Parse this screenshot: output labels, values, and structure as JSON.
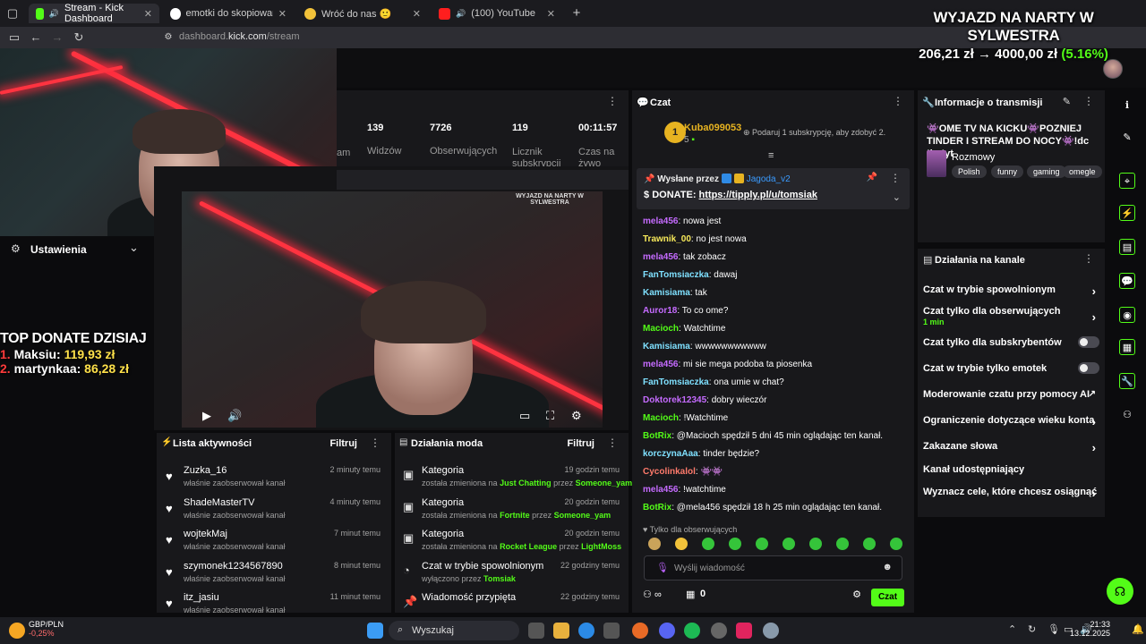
{
  "browser": {
    "tabs": [
      {
        "title": "Stream - Kick Dashboard",
        "active": true
      },
      {
        "title": "emotki do skopiowania - Szuka"
      },
      {
        "title": "Wróć do nas 🙂"
      },
      {
        "title": "(100) YouTube"
      }
    ],
    "url_host": "dashboard.",
    "url_domain": "kick.com",
    "url_path": "/stream"
  },
  "overlay": {
    "goal_title": "WYJAZD NA NARTY W SYLWESTRA",
    "goal_value": "206,21 zł → 4000,00 zł",
    "goal_percent": "(5.16%)",
    "goal_progress": 0.0516,
    "top_donate_title": "TOP DONATE DZISIAJ",
    "top_donate": [
      {
        "rank": "1.",
        "name": "Maksiu:",
        "amount": "119,93 zł"
      },
      {
        "rank": "2.",
        "name": "martynkaa:",
        "amount": "86,28 zł"
      }
    ]
  },
  "settings_label": "Ustawienia",
  "stats": [
    {
      "value": "139",
      "label": "Widzów"
    },
    {
      "value": "7726",
      "label": "Obserwujących"
    },
    {
      "value": "119",
      "label": "Licznik subskrypcji"
    },
    {
      "value": "00:11:57",
      "label": "Czas na żywo"
    }
  ],
  "stats_partial_label": "am",
  "activity": {
    "title": "Lista aktywności",
    "filter": "Filtruj",
    "items": [
      {
        "name": "Zuzka_16",
        "sub": "właśnie zaobserwował kanał",
        "time": "2 minuty temu"
      },
      {
        "name": "ShadeMasterTV",
        "sub": "właśnie zaobserwował kanał",
        "time": "4 minuty temu"
      },
      {
        "name": "wojtekMaj",
        "sub": "właśnie zaobserwował kanał",
        "time": "7 minut temu"
      },
      {
        "name": "szymonek1234567890",
        "sub": "właśnie zaobserwował kanał",
        "time": "8 minut temu"
      },
      {
        "name": "itz_jasiu",
        "sub": "właśnie zaobserwował kanał",
        "time": "11 minut temu"
      }
    ]
  },
  "mods": {
    "title": "Działania moda",
    "filter": "Filtruj",
    "items": [
      {
        "name": "Kategoria",
        "pre": "została zmieniona na",
        "target": "Just Chatting",
        "mid": "przez",
        "by": "Someone_yam",
        "time": "19 godzin temu"
      },
      {
        "name": "Kategoria",
        "pre": "została zmieniona na",
        "target": "Fortnite",
        "mid": "przez",
        "by": "Someone_yam",
        "time": "20 godzin temu"
      },
      {
        "name": "Kategoria",
        "pre": "została zmieniona na",
        "target": "Rocket League",
        "mid": "przez",
        "by": "LightMoss",
        "time": "20 godzin temu"
      },
      {
        "name": "Czat w trybie spowolnionym",
        "pre": "wyłączono przez",
        "target": "Tomsiak",
        "mid": "",
        "by": "",
        "time": "22 godziny temu"
      },
      {
        "name": "Wiadomość przypięta",
        "pre": "",
        "target": "",
        "mid": "",
        "by": "",
        "time": "22 godziny temu"
      }
    ]
  },
  "chat": {
    "title": "Czat",
    "leader_rank": "1",
    "leader_name": "Kuba099053",
    "leader_count": "5",
    "sub_hint": "Podaruj 1 subskrypcję, aby zdobyć 2.",
    "pinned_by_label": "Wysłane przez",
    "pinned_by_user": "Jagoda_v2",
    "pinned_msg_prefix": "DONATE:",
    "pinned_msg_link": "https://tipply.pl/u/tomsiak",
    "messages": [
      {
        "user": "mela456",
        "color": "#c56bff",
        "text": ": nowa jest"
      },
      {
        "user": "Trawnik_00",
        "color": "#f7e95a",
        "text": ": no jest nowa"
      },
      {
        "user": "mela456",
        "color": "#c56bff",
        "text": ": tak zobacz"
      },
      {
        "user": "FanTomsiaczka",
        "color": "#7fe0ff",
        "text": ": dawaj"
      },
      {
        "user": "Kamisiama",
        "color": "#7fe0ff",
        "text": ": tak"
      },
      {
        "user": "Auror18",
        "color": "#c56bff",
        "text": ": To co ome?"
      },
      {
        "user": "Macioch",
        "color": "#53fc18",
        "text": ": Watchtime"
      },
      {
        "user": "Kamisiama",
        "color": "#7fe0ff",
        "text": ": wwwwwwwwwww"
      },
      {
        "user": "mela456",
        "color": "#c56bff",
        "text": ": mi sie mega podoba ta piosenka"
      },
      {
        "user": "FanTomsiaczka",
        "color": "#7fe0ff",
        "text": ": ona umie w chat?"
      },
      {
        "user": "Doktorek12345",
        "color": "#c56bff",
        "text": ": dobry wieczór"
      },
      {
        "user": "Macioch",
        "color": "#53fc18",
        "text": ": !Watchtime"
      },
      {
        "user": "BotRix",
        "color": "#53fc18",
        "text": ": @Macioch spędził 5 dni 45 min oglądając ten kanał."
      },
      {
        "user": "korczynaAaa",
        "color": "#7fe0ff",
        "text": ": tinder będzie?"
      },
      {
        "user": "Cycolinkalol",
        "color": "#ff7a6b",
        "text": ": 👾👾"
      },
      {
        "user": "mela456",
        "color": "#c56bff",
        "text": ": !watchtime"
      },
      {
        "user": "BotRix",
        "color": "#53fc18",
        "text": ": @mela456 spędził 18 h 25 min oglądając ten kanał."
      }
    ],
    "only_followers": "♥ Tylko dla obserwujących",
    "input_placeholder": "Wyślij wiadomość",
    "infinity": "∞",
    "gift_count": "0",
    "send_label": "Czat"
  },
  "info": {
    "title": "Informacje o transmisji",
    "stream_title": "👾OME TV NA KICKU👾POZNIEJ TINDER I STREAM DO NOCY👾!dc !ig !yt",
    "category": "Rozmowy",
    "tags": [
      "Polish",
      "funny",
      "gaming",
      "omegle"
    ]
  },
  "actions": {
    "title": "Działania na kanale",
    "items": [
      {
        "label": "Czat w trybie spowolnionym",
        "sub": "",
        "kind": "chevron"
      },
      {
        "label": "Czat tylko dla obserwujących",
        "sub": "1 min",
        "kind": "chevron"
      },
      {
        "label": "Czat tylko dla subskrybentów",
        "sub": "",
        "kind": "toggle"
      },
      {
        "label": "Czat w trybie tylko emotek",
        "sub": "",
        "kind": "toggle"
      },
      {
        "label": "Moderowanie czatu przy pomocy AI",
        "sub": "",
        "kind": "external"
      },
      {
        "label": "Ograniczenie dotyczące wieku konta",
        "sub": "",
        "kind": "chevron"
      },
      {
        "label": "Zakazane słowa",
        "sub": "",
        "kind": "chevron"
      },
      {
        "label": "Kanał udostępniający",
        "sub": "",
        "kind": "none"
      },
      {
        "label": "Wyznacz cele, które chcesz osiągnąć",
        "sub": "",
        "kind": "chevron"
      }
    ]
  },
  "taskbar": {
    "ticker_name": "GBP/PLN",
    "ticker_change": "-0,25%",
    "search": "Wyszukaj",
    "time": "21:33",
    "date": "13.12.2025"
  },
  "colors": {
    "accent": "#53fc18",
    "kick_bg": "#18181b",
    "laser": "#ff3340"
  }
}
